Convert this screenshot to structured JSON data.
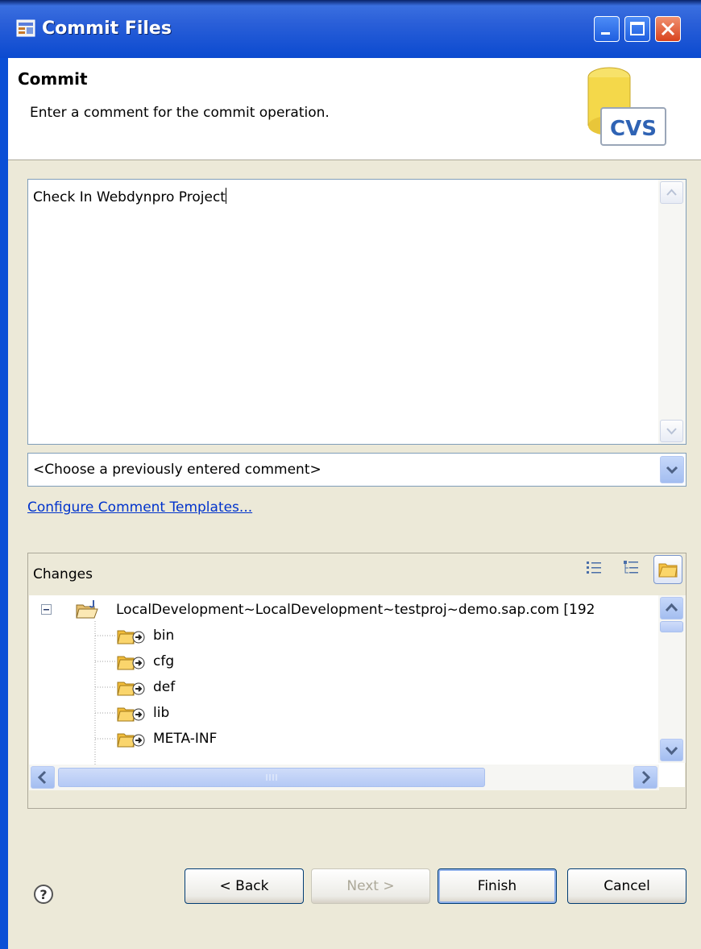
{
  "window": {
    "title": "Commit Files"
  },
  "header": {
    "title": "Commit",
    "description": "Enter a comment for the commit operation.",
    "logo_text": "CVS"
  },
  "comment": {
    "value": "Check In Webdynpro Project"
  },
  "previous_comment": {
    "selected": "<Choose a previously entered comment>"
  },
  "templates_link": "Configure Comment Templates...",
  "changes": {
    "label": "Changes",
    "root": "LocalDevelopment~LocalDevelopment~testproj~demo.sap.com  [192",
    "children": [
      "bin",
      "cfg",
      "def",
      "lib",
      "META-INF"
    ]
  },
  "buttons": {
    "back": "< Back",
    "next": "Next >",
    "finish": "Finish",
    "cancel": "Cancel"
  },
  "icons": {
    "help": "help-icon",
    "flat": "flat-list-icon",
    "tree": "tree-view-icon",
    "compressed": "compressed-folders-icon"
  }
}
